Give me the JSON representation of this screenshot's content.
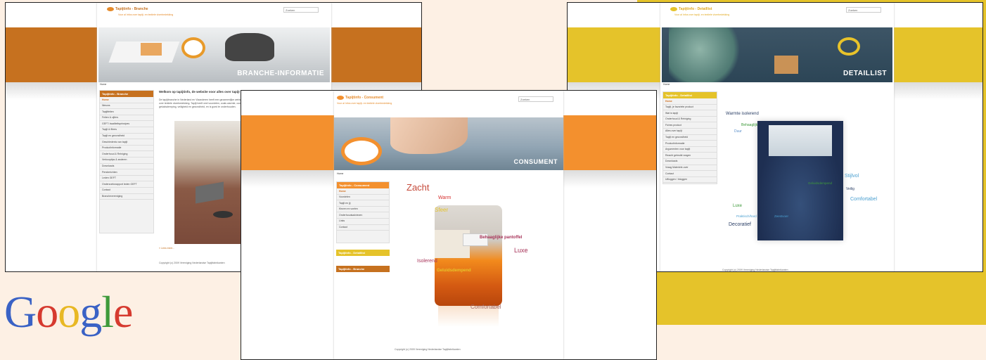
{
  "colors": {
    "orange": "#c6711f",
    "brightOrange": "#f3902e",
    "yellow": "#e5c32a",
    "bg": "#fdf0e4"
  },
  "branche": {
    "brand": "Tapijtinfo - Branche",
    "tagline": "Voor al Infos over tapijt- en textiele vloerbedekking",
    "search": "Zoeken",
    "hero_label": "BRANCHE-INFORMATIE",
    "crumb": "Home",
    "heading": "Welkom op tapijtinfo, de website voor alles over tapijt",
    "intro": "De tapijtbranche in Nederland en Vlaanderen heeft een gezamenlijke website over textiele vloerbedekking. Tapijt heeft veel voordelen, zoals warmte, comfort, geluidsdemping, veiligheid en gezondheid, en is goed te onderhouden.",
    "side_head": "Tapijtinfo - Branche",
    "items": [
      "Home",
      "Nieuws",
      "Tapijtfeiten",
      "Feiten & cijfers",
      "GEFT: kwaliteitsprincipes",
      "Tapijt & fibres",
      "Tapijt en gezondheid",
      "Geschiedenis van tapijt",
      "Productinformatie",
      "Onderhoud & Reiniging",
      "Verkooptips & anderen",
      "Downloads",
      "Persberichten",
      "Leden GEFT",
      "Onderzoeksrapport leden GEFT",
      "Contact",
      "Branchevereniging"
    ],
    "more": "» Lees meer...",
    "footer": "Copyright (c) 2009 Vereniging Nederlandse Tapijtfabrikanten"
  },
  "detaillist": {
    "brand": "Tapijtinfo - Detaillist",
    "tagline": "Voor al Infos over tapijt- en textiele vloerbedekking",
    "search": "Zoeken",
    "hero_label": "DETAILLIST",
    "crumb": "Home",
    "side_head": "Tapijtinfo - Detaillist",
    "items": [
      "Home",
      "Tapijt, je favoriete product",
      "Wat is tapijt",
      "Onderhoud & Reiniging",
      "Fiches product",
      "Alles over tapijt",
      "Tapijt en gezondheid",
      "Productinformatie",
      "Argumenten voor tapijt",
      "Reacht gebruikt vragen",
      "Downloads",
      "Vraag Materiele-over",
      "Contact",
      "Uitloggen / Inloggen"
    ],
    "words": [
      "Warmte isolerend",
      "Behaaglijk",
      "Duur",
      "Stijlvol",
      "Geluidsdempend",
      "Veilig",
      "Comfortabel",
      "Luxe",
      "Praktisch/hard",
      "Zeestvoer",
      "Decoratief"
    ],
    "footer": "Copyright (c) 2009 Vereniging Nederlandse Tapijtfabrikanten"
  },
  "consument": {
    "brand": "Tapijtinfo - Consument",
    "tagline": "Voor al Infos over tapijt- en textiele vloerbedekking",
    "search": "Zoeken",
    "hero_label": "CONSUMENT",
    "crumb": "Home",
    "side_head": "Tapijtinfo - Consument",
    "items": [
      "Home",
      "Voordelen",
      "Tapijt en jij",
      "Kiezen en voelen",
      "Onderhoudsadviezen",
      "Links",
      "Contact"
    ],
    "alt_heads": [
      "Tapijtinfo - Detaillist",
      "Tapijtinfo - Branche"
    ],
    "words": [
      "Zacht",
      "Warm",
      "Sfeer",
      "Behaaglijke pantoffel",
      "Luxe",
      "Isolerend",
      "Geluidsdempend",
      "Comfortabel"
    ],
    "footer": "Copyright (c) 2009 Vereniging Nederlandse Tapijtfabrikanten"
  },
  "google": {
    "letters": [
      "G",
      "o",
      "o",
      "g",
      "l",
      "e"
    ],
    "colors": [
      "#3a62c5",
      "#d63a2f",
      "#e8b824",
      "#3a62c5",
      "#3e9a3a",
      "#d63a2f"
    ]
  }
}
